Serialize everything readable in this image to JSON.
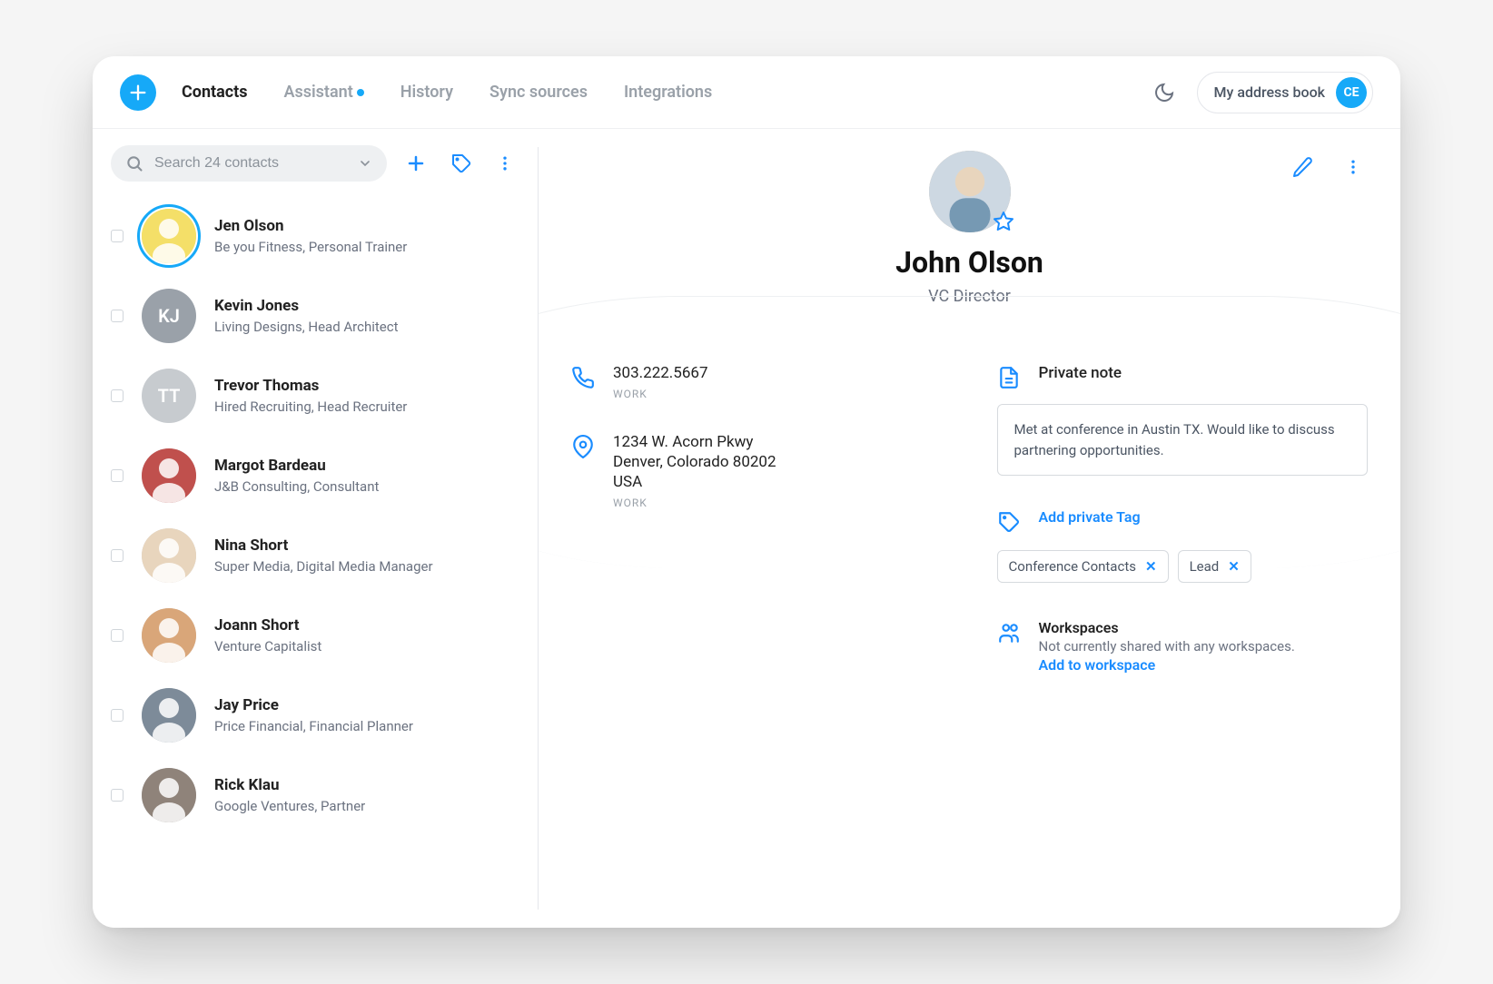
{
  "nav": {
    "items": [
      "Contacts",
      "Assistant",
      "History",
      "Sync sources",
      "Integrations"
    ],
    "active": 0,
    "hasDot": 1
  },
  "topRight": {
    "label": "My address book",
    "initials": "CE"
  },
  "search": {
    "placeholder": "Search 24 contacts"
  },
  "contacts": [
    {
      "name": "Jen Olson",
      "sub": "Be you Fitness, Personal Trainer",
      "initials": "",
      "selected": true,
      "photo": true,
      "bg": "#f4df68"
    },
    {
      "name": "Kevin Jones",
      "sub": "Living Designs, Head Architect",
      "initials": "KJ",
      "selected": false,
      "photo": false,
      "bg": "#9aa1a9"
    },
    {
      "name": "Trevor Thomas",
      "sub": "Hired Recruiting, Head Recruiter",
      "initials": "TT",
      "selected": false,
      "photo": false,
      "bg": "#c7cbcf"
    },
    {
      "name": "Margot Bardeau",
      "sub": "J&B Consulting, Consultant",
      "initials": "",
      "selected": false,
      "photo": true,
      "bg": "#c0504d"
    },
    {
      "name": "Nina Short",
      "sub": "Super Media, Digital Media Manager",
      "initials": "",
      "selected": false,
      "photo": true,
      "bg": "#e8d5bd"
    },
    {
      "name": "Joann Short",
      "sub": "Venture Capitalist",
      "initials": "",
      "selected": false,
      "photo": true,
      "bg": "#d9a679"
    },
    {
      "name": "Jay Price",
      "sub": "Price Financial, Financial Planner",
      "initials": "",
      "selected": false,
      "photo": true,
      "bg": "#7d8b99"
    },
    {
      "name": "Rick Klau",
      "sub": "Google Ventures, Partner",
      "initials": "",
      "selected": false,
      "photo": true,
      "bg": "#8f837a"
    }
  ],
  "detail": {
    "name": "John Olson",
    "title": "VC Director",
    "phone": "303.222.5667",
    "phoneLabel": "WORK",
    "addressLines": [
      "1234 W. Acorn Pkwy",
      "Denver, Colorado 80202",
      "USA"
    ],
    "addressLabel": "WORK",
    "noteLabel": "Private note",
    "note": "Met at conference in Austin TX. Would like to discuss partnering opportunities.",
    "addTagLabel": "Add private Tag",
    "tags": [
      "Conference Contacts",
      "Lead"
    ],
    "workspaces": {
      "title": "Workspaces",
      "sub": "Not currently shared with any workspaces.",
      "link": "Add to workspace"
    }
  }
}
